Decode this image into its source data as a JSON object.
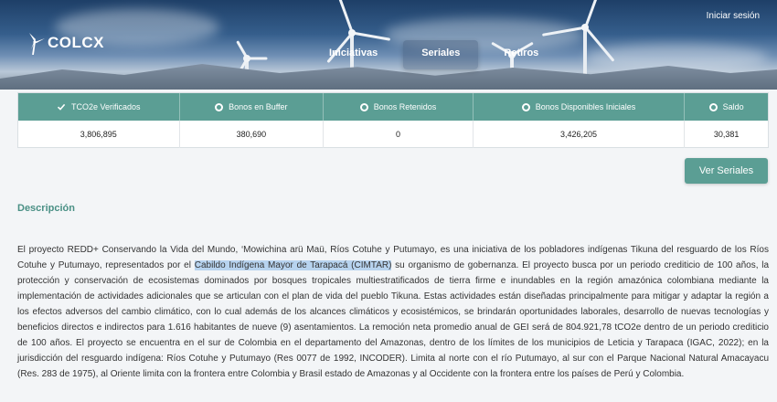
{
  "header": {
    "brand": "COLCX",
    "login": "Iniciar sesión",
    "nav": [
      {
        "label": "Iniciativas"
      },
      {
        "label": "Seriales"
      },
      {
        "label": "Retiros"
      }
    ]
  },
  "stats": {
    "headers": [
      {
        "label": "TCO2e Verificados",
        "icon": "check-icon"
      },
      {
        "label": "Bonos en Buffer",
        "icon": "globe-icon"
      },
      {
        "label": "Bonos Retenidos",
        "icon": "globe-icon"
      },
      {
        "label": "Bonos Disponibles Iniciales",
        "icon": "globe-icon"
      },
      {
        "label": "Saldo",
        "icon": "globe-icon"
      }
    ],
    "values": [
      "3,806,895",
      "380,690",
      "0",
      "3,426,205",
      "30,381"
    ]
  },
  "actions": {
    "ver_seriales": "Ver Seriales"
  },
  "description": {
    "title": "Descripción",
    "text_before": "El proyecto REDD+ Conservando la Vida del Mundo, ‘Mowichina arü Maü, Ríos Cotuhe y Putumayo, es una iniciativa de los pobladores indígenas Tikuna del resguardo de los Ríos Cotuhe y Putumayo, representados por el ",
    "highlight": "Cabildo Indígena Mayor de Tarapacá (CIMTAR)",
    "text_after": " su organismo de gobernanza. El proyecto busca por un periodo crediticio de 100 años, la protección y conservación de ecosistemas dominados por bosques tropicales multiestratificados de tierra firme e inundables en la región amazónica colombiana mediante la implementación de actividades adicionales que se articulan con el plan de vida del pueblo Tikuna. Estas actividades están diseñadas principalmente para mitigar y adaptar la región a los efectos adversos del cambio climático, con lo cual además de los alcances climáticos y ecosistémicos, se brindarán oportunidades laborales, desarrollo de nuevas tecnologías y beneficios directos e indirectos para 1.616 habitantes de nueve (9) asentamientos. La remoción neta promedio anual de GEI será de 804.921,78 tCO2e dentro de un periodo crediticio de 100 años. El proyecto se encuentra en el sur de Colombia en el departamento del Amazonas, dentro de los límites de los municipios de Leticia y Tarapaca (IGAC, 2022); en la jurisdicción del resguardo indígena: Ríos Cotuhe y Putumayo (Res 0077 de 1992, INCODER). Limita al norte con el río Putumayo, al sur con el Parque Nacional Natural Amacayacu (Res. 283 de 1975), al Oriente limita con la frontera entre Colombia y Brasil estado de Amazonas y al Occidente con la frontera entre los países de Perú y Colombia."
  },
  "colors": {
    "accent": "#5b9e94",
    "title": "#4a9085",
    "highlight": "#b7d3ef"
  }
}
